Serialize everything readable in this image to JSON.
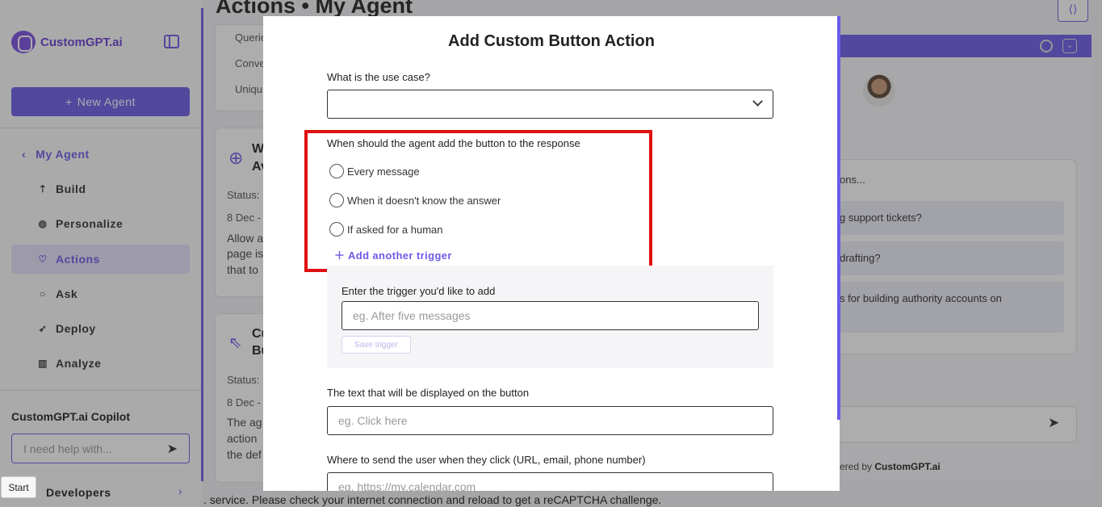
{
  "sidebar": {
    "logo_text": "CustomGPT.ai",
    "new_agent_label": "New Agent",
    "back_label": "My Agent",
    "items": [
      {
        "label": "Build",
        "icon": "build-icon"
      },
      {
        "label": "Personalize",
        "icon": "palette-icon"
      },
      {
        "label": "Actions",
        "icon": "actions-icon",
        "active": true
      },
      {
        "label": "Ask",
        "icon": "chat-bubble-icon"
      },
      {
        "label": "Deploy",
        "icon": "rocket-icon"
      },
      {
        "label": "Analyze",
        "icon": "bar-chart-icon"
      }
    ],
    "copilot_title": "CustomGPT.ai Copilot",
    "copilot_placeholder": "I need help with...",
    "developers_label": "Developers",
    "start_tooltip": "Start"
  },
  "main": {
    "page_title": "Actions • My Agent",
    "top_card_rows": [
      "Querie",
      "Conve",
      "Uniqu"
    ],
    "card1": {
      "title_lines": [
        "W",
        "Av"
      ],
      "status": "Status:",
      "date": "8 Dec -",
      "body": [
        "Allow a",
        "page is",
        "that to"
      ]
    },
    "card2": {
      "title_lines": [
        "Cu",
        "Bu"
      ],
      "status": "Status:",
      "date": "8 Dec -",
      "body": [
        "The ag",
        "action",
        "the def"
      ]
    }
  },
  "chat_preview": {
    "suggestions_label": "ons...",
    "suggestions": [
      "g support tickets?",
      "drafting?",
      "s for building authority accounts on"
    ],
    "powered_prefix": "ered by ",
    "powered_brand": "CustomGPT.ai"
  },
  "modal": {
    "title": "Add Custom Button Action",
    "use_case_label": "What is the use case?",
    "use_case_value": "",
    "when_label": "When should the agent add the button to the response",
    "options": [
      "Every message",
      "When it doesn't know the answer",
      "If asked for a human"
    ],
    "add_trigger_label": "Add another trigger",
    "trigger_label": "Enter the trigger you'd like to add",
    "trigger_placeholder": "eg. After five messages",
    "save_trigger_label": "Save trigger",
    "button_text_label": "The text that will be displayed on the button",
    "button_text_placeholder": "eg. Click here",
    "destination_label": "Where to send the user when they click (URL, email, phone number)",
    "destination_placeholder": "eg. https://my.calendar.com"
  },
  "recaptcha_notice": ". service. Please check your internet connection and reload to get a reCAPTCHA challenge.",
  "colors": {
    "accent": "#6c5ce7",
    "highlight": "#e01010"
  }
}
